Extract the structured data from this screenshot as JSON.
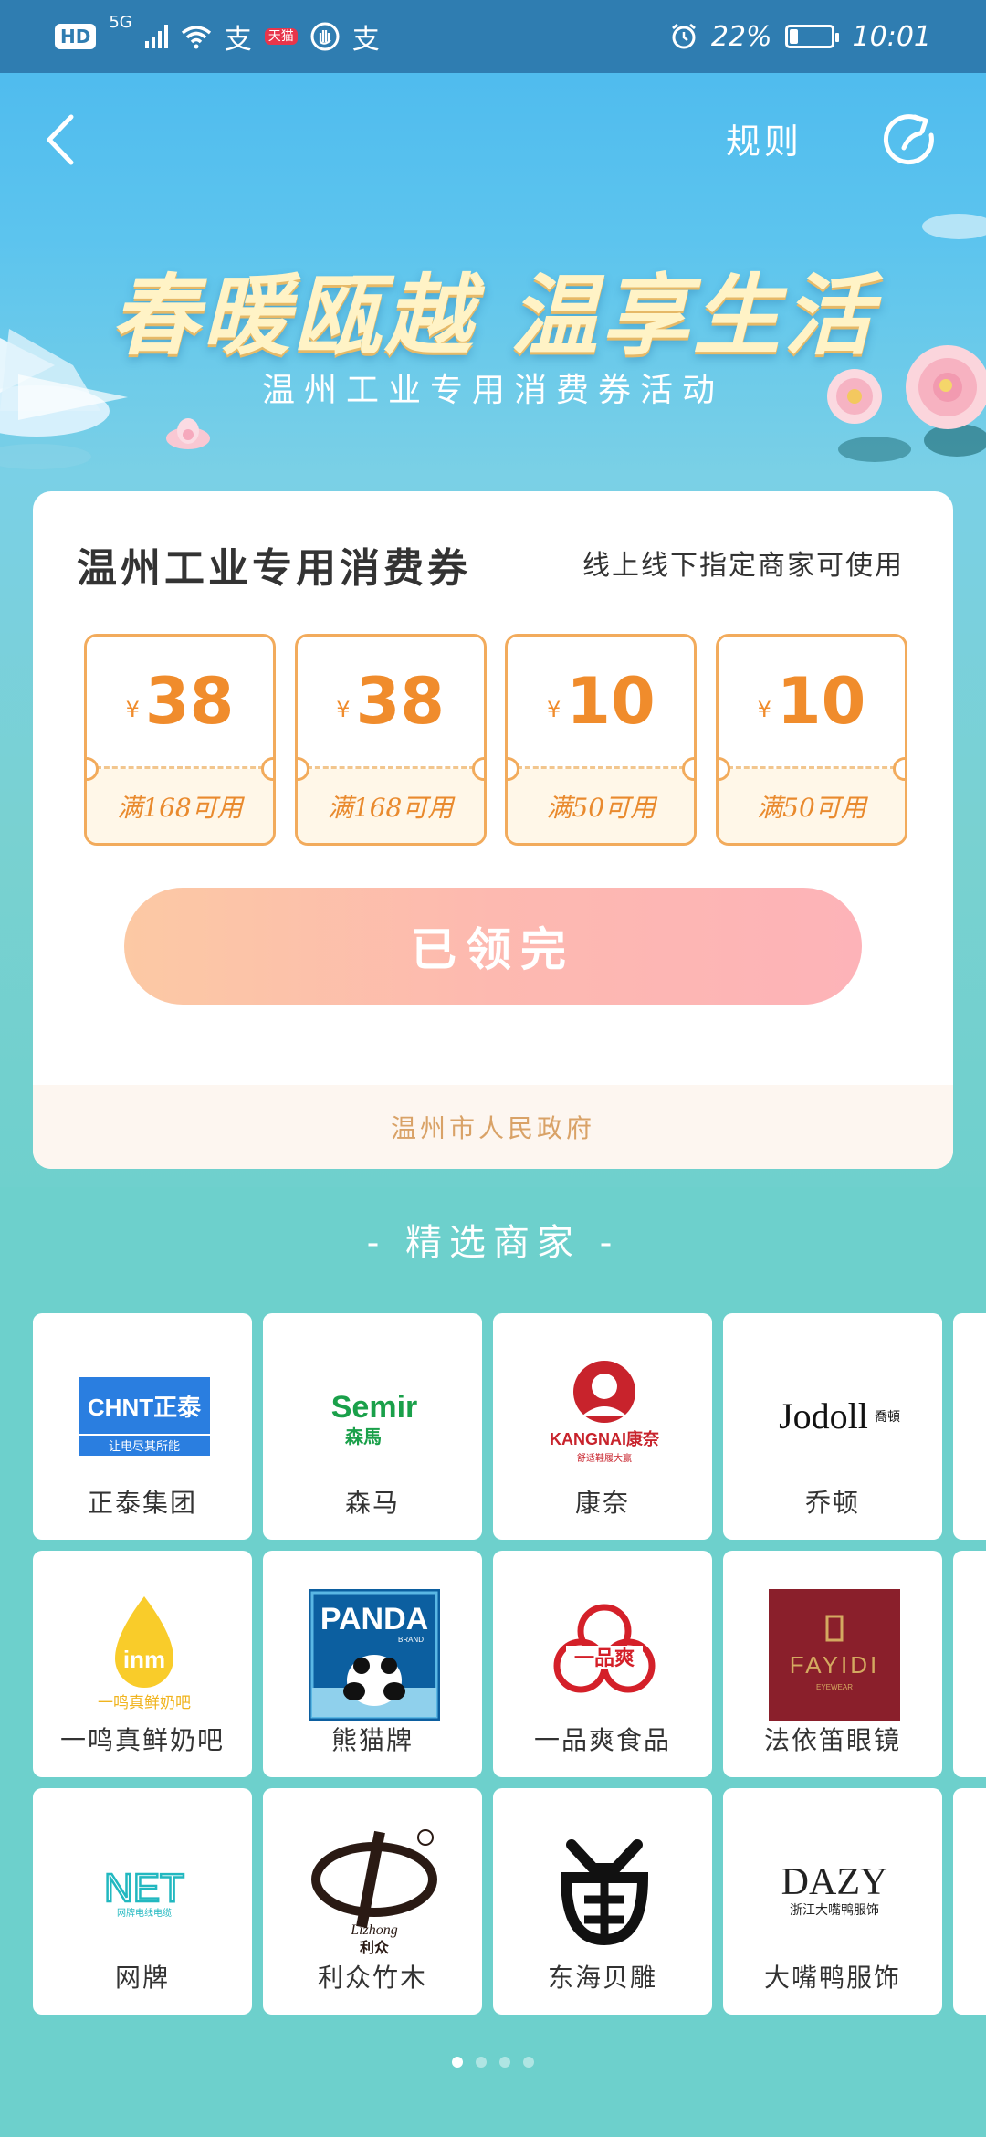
{
  "status_bar": {
    "hd": "HD",
    "network": "5G",
    "app_icon_1": "支",
    "app_icon_2": "天猫",
    "app_icon_3": "支",
    "battery_percent": "22%",
    "battery_level": 0.22,
    "time": "10:01"
  },
  "header": {
    "back_icon": "back-chevron-icon",
    "rules_label": "规则",
    "refresh_icon": "refresh-icon"
  },
  "hero": {
    "title": "春暖瓯越 温享生活",
    "subtitle": "温州工业专用消费券活动"
  },
  "coupon_card": {
    "title": "温州工业专用消费券",
    "note": "线上线下指定商家可使用",
    "tickets": [
      {
        "currency": "¥",
        "amount": "38",
        "condition": "满168可用"
      },
      {
        "currency": "¥",
        "amount": "38",
        "condition": "满168可用"
      },
      {
        "currency": "¥",
        "amount": "10",
        "condition": "满50可用"
      },
      {
        "currency": "¥",
        "amount": "10",
        "condition": "满50可用"
      }
    ],
    "claim_button": "已领完",
    "footer": "温州市人民政府"
  },
  "merchants": {
    "section_title": "- 精选商家 -",
    "items": [
      {
        "name": "正泰集团",
        "logo_text": "CHNT正泰",
        "logo_sub": "让电尽其所能"
      },
      {
        "name": "森马",
        "logo_text": "Semir",
        "logo_sub": "森馬"
      },
      {
        "name": "康奈",
        "logo_text": "KANGNAI康奈",
        "logo_sub": "舒适鞋履大赢"
      },
      {
        "name": "乔顿",
        "logo_text": "Jodoll",
        "logo_sub": "喬頓"
      },
      {
        "name": "一鸣真鲜奶吧",
        "logo_text": "inm",
        "logo_sub": "一鸣真鲜奶吧"
      },
      {
        "name": "熊猫牌",
        "logo_text": "PANDA",
        "logo_sub": "BRAND"
      },
      {
        "name": "一品爽食品",
        "logo_text": "一品爽",
        "logo_sub": ""
      },
      {
        "name": "法依笛眼镜",
        "logo_text": "FAYIDI",
        "logo_sub": "EYEWEAR"
      },
      {
        "name": "网牌",
        "logo_text": "NET",
        "logo_sub": "网牌电线电缆"
      },
      {
        "name": "利众竹木",
        "logo_text": "Lizhong",
        "logo_sub": "利众"
      },
      {
        "name": "东海贝雕",
        "logo_text": "",
        "logo_sub": ""
      },
      {
        "name": "大嘴鸭服饰",
        "logo_text": "DAZY",
        "logo_sub": "浙江大嘴鸭服饰"
      }
    ]
  },
  "pager": {
    "count": 4,
    "active": 1
  },
  "colors": {
    "accent_orange": "#f08c2c",
    "status_bar": "#2f7db1",
    "page_bg": "#6dd0cc"
  }
}
